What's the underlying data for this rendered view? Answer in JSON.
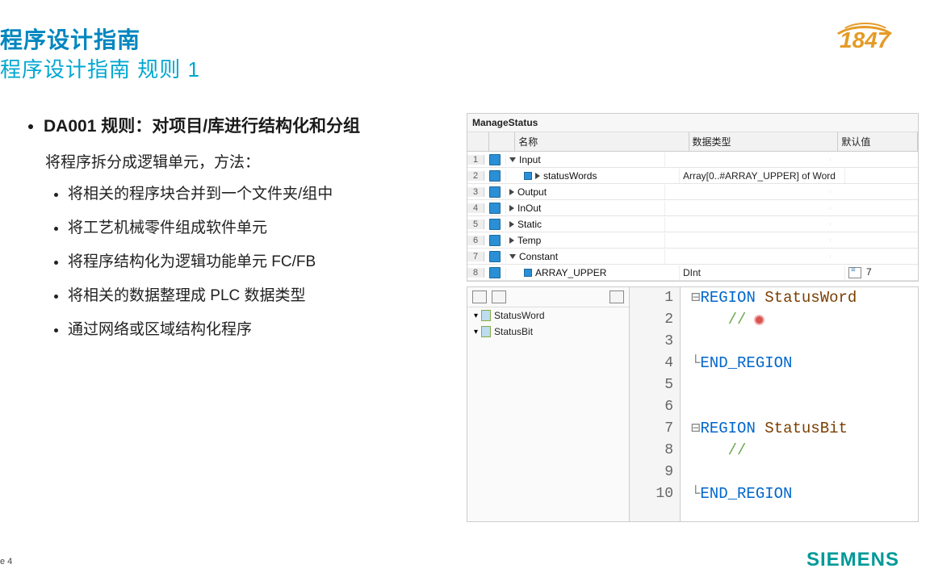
{
  "header": {
    "title_main": "程序设计指南",
    "title_sub": "程序设计指南 规则 1",
    "logo_year": "1847"
  },
  "footer": {
    "page": "e 4",
    "brand": "SIEMENS"
  },
  "bullets": {
    "main": "DA001 规则：对项目/库进行结构化和分组",
    "intro": "将程序拆分成逻辑单元，方法：",
    "items": [
      "将相关的程序块合并到一个文件夹/组中",
      "将工艺机械零件组成软件单元",
      "将程序结构化为逻辑功能单元 FC/FB",
      "将相关的数据整理成 PLC 数据类型",
      "通过网络或区域结构化程序"
    ]
  },
  "table": {
    "title": "ManageStatus",
    "headers": {
      "name": "名称",
      "dtype": "数据类型",
      "defv": "默认值"
    },
    "rows": [
      {
        "n": "1",
        "name": "Input",
        "indent": 0,
        "chev": "down",
        "dtype": "",
        "defv": ""
      },
      {
        "n": "2",
        "name": "statusWords",
        "indent": 1,
        "chev": "right",
        "dtype": "Array[0..#ARRAY_UPPER] of Word",
        "defv": ""
      },
      {
        "n": "3",
        "name": "Output",
        "indent": 0,
        "chev": "right",
        "dtype": "",
        "defv": ""
      },
      {
        "n": "4",
        "name": "InOut",
        "indent": 0,
        "chev": "right",
        "dtype": "",
        "defv": ""
      },
      {
        "n": "5",
        "name": "Static",
        "indent": 0,
        "chev": "right",
        "dtype": "",
        "defv": ""
      },
      {
        "n": "6",
        "name": "Temp",
        "indent": 0,
        "chev": "right",
        "dtype": "",
        "defv": ""
      },
      {
        "n": "7",
        "name": "Constant",
        "indent": 0,
        "chev": "down",
        "dtype": "",
        "defv": ""
      },
      {
        "n": "8",
        "name": "ARRAY_UPPER",
        "indent": 1,
        "chev": "",
        "dtype": "DInt",
        "defv": "7",
        "dd": true
      }
    ]
  },
  "tree": {
    "items": [
      "StatusWord",
      "StatusBit"
    ]
  },
  "code": {
    "lines": [
      {
        "n": "1",
        "t": "REGION",
        "id": "StatusWord",
        "kind": "open"
      },
      {
        "n": "2",
        "t": "//",
        "kind": "comment",
        "dot": true
      },
      {
        "n": "3",
        "t": "",
        "kind": "blank"
      },
      {
        "n": "4",
        "t": "END_REGION",
        "kind": "close"
      },
      {
        "n": "5",
        "t": "",
        "kind": "blank"
      },
      {
        "n": "6",
        "t": "",
        "kind": "blank"
      },
      {
        "n": "7",
        "t": "REGION",
        "id": "StatusBit",
        "kind": "open"
      },
      {
        "n": "8",
        "t": "//",
        "kind": "comment"
      },
      {
        "n": "9",
        "t": "",
        "kind": "blank"
      },
      {
        "n": "10",
        "t": "END_REGION",
        "kind": "close"
      }
    ]
  }
}
